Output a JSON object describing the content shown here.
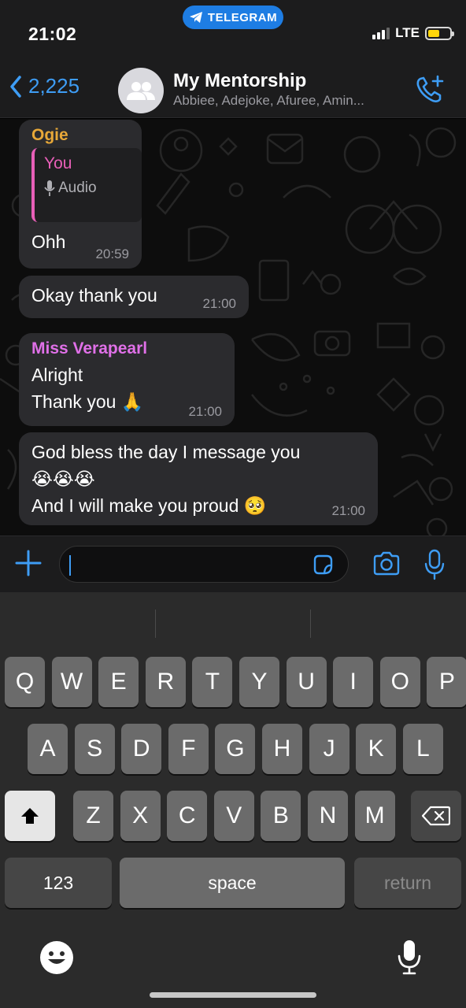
{
  "status_bar": {
    "time": "21:02",
    "app_pill": "TELEGRAM",
    "network": "LTE",
    "battery_level": 0.55
  },
  "header": {
    "back_count": "2,225",
    "title": "My Mentorship",
    "members": "Abbiee, Adejoke, Afuree, Amin..."
  },
  "messages": [
    {
      "sender": "Ogie",
      "sender_color": "#e8a838",
      "reply_to": {
        "name": "You",
        "content": "Audio"
      },
      "text": "Ohh",
      "time": "20:59"
    },
    {
      "text": "Okay thank you",
      "time": "21:00"
    },
    {
      "sender": "Miss Verapearl",
      "sender_color": "#e070e8",
      "line1": "Alright",
      "line2": "Thank you 🙏",
      "time": "21:00"
    },
    {
      "line1": "God bless the day I message you",
      "line2": "😭😭😭",
      "line3": "And I will make you proud 🥺",
      "time": "21:00"
    }
  ],
  "input": {
    "value": "",
    "placeholder": ""
  },
  "keyboard": {
    "row1": [
      "Q",
      "W",
      "E",
      "R",
      "T",
      "Y",
      "U",
      "I",
      "O",
      "P"
    ],
    "row2": [
      "A",
      "S",
      "D",
      "F",
      "G",
      "H",
      "J",
      "K",
      "L"
    ],
    "row3": [
      "Z",
      "X",
      "C",
      "V",
      "B",
      "N",
      "M"
    ],
    "numbers": "123",
    "space": "space",
    "return": "return"
  },
  "colors": {
    "accent": "#3e9df5",
    "bubble": "#2b2b2e",
    "reply_bar": "#e85fb8"
  }
}
